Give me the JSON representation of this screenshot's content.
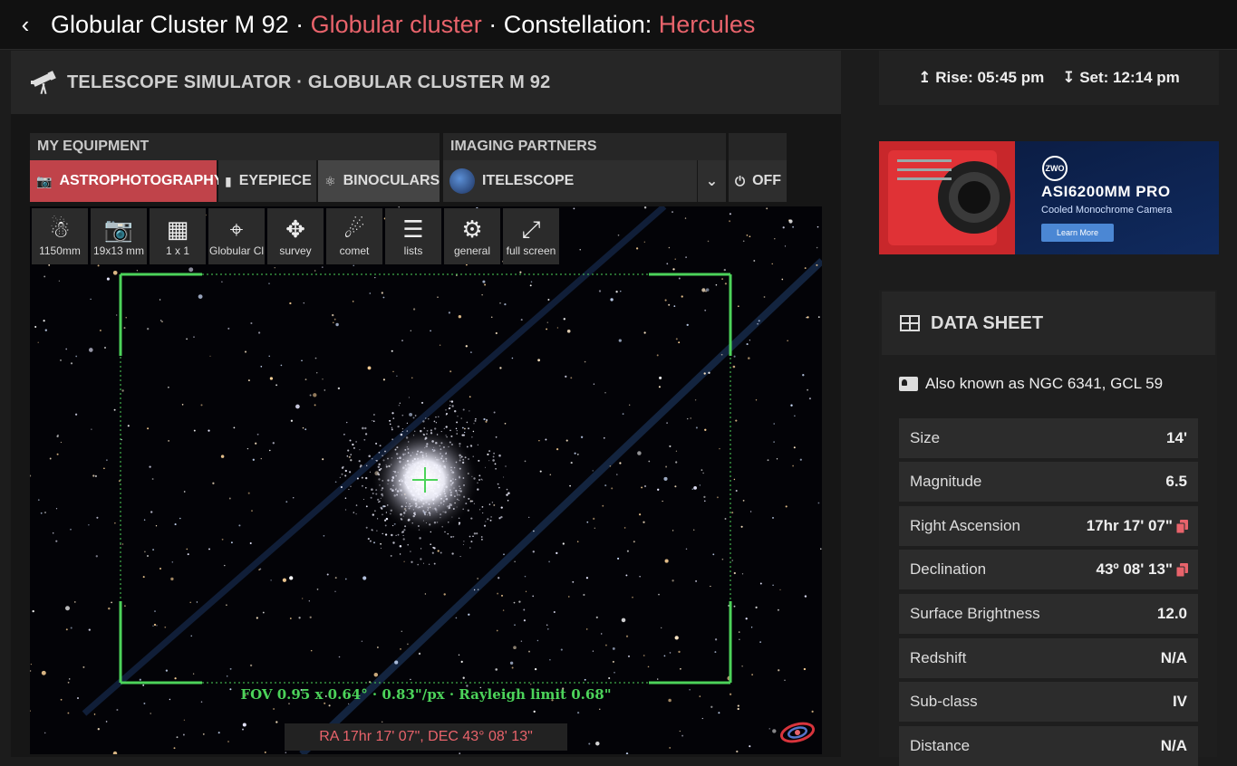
{
  "header": {
    "title_part1": "Globular Cluster M 92",
    "sep1": " · ",
    "type": "Globular cluster",
    "sep2": " · Constellation: ",
    "constellation": "Hercules"
  },
  "simulator": {
    "title": "TELESCOPE SIMULATOR · GLOBULAR CLUSTER M 92",
    "my_equipment_label": "MY EQUIPMENT",
    "imaging_partners_label": "IMAGING PARTNERS",
    "modes": [
      "ASTROPHOTOGRAPHY",
      "EYEPIECE",
      "BINOCULARS"
    ],
    "partner": "ITELESCOPE",
    "off_label": "OFF",
    "tools": [
      {
        "label": "1150mm",
        "icon": "telescope-icon"
      },
      {
        "label": "19x13 mm",
        "icon": "camera-icon"
      },
      {
        "label": "1 x 1",
        "icon": "grid-icon"
      },
      {
        "label": "Globular Cl",
        "icon": "crosshair-icon"
      },
      {
        "label": "survey",
        "icon": "satellite-icon"
      },
      {
        "label": "comet",
        "icon": "comet-icon"
      },
      {
        "label": "lists",
        "icon": "list-icon"
      },
      {
        "label": "general",
        "icon": "gear-icon"
      },
      {
        "label": "full screen",
        "icon": "expand-icon"
      }
    ],
    "fov_text": "FOV 0.95 x 0.64° · 0.83\"/px · Rayleigh limit 0.68\"",
    "radec": "RA 17hr 17' 07\", DEC 43° 08' 13\"",
    "accent_color": "#c0434a",
    "fov_color": "#4cd35a"
  },
  "rise_set": {
    "rise": "Rise: 05:45 pm",
    "set": "Set: 12:14 pm"
  },
  "ad": {
    "brand": "ZWO",
    "model": "ASI6200MM PRO",
    "subtitle": "Cooled Monochrome Camera",
    "cta": "Learn More"
  },
  "datasheet": {
    "title": "DATA SHEET",
    "aka": "Also known as NGC 6341, GCL 59",
    "rows": [
      {
        "key": "Size",
        "value": "14'"
      },
      {
        "key": "Magnitude",
        "value": "6.5"
      },
      {
        "key": "Right Ascension",
        "value": "17hr 17' 07\""
      },
      {
        "key": "Declination",
        "value": "43º 08' 13\""
      },
      {
        "key": "Surface Brightness",
        "value": "12.0"
      },
      {
        "key": "Redshift",
        "value": "N/A"
      },
      {
        "key": "Sub-class",
        "value": "IV"
      },
      {
        "key": "Distance",
        "value": "N/A"
      }
    ]
  }
}
